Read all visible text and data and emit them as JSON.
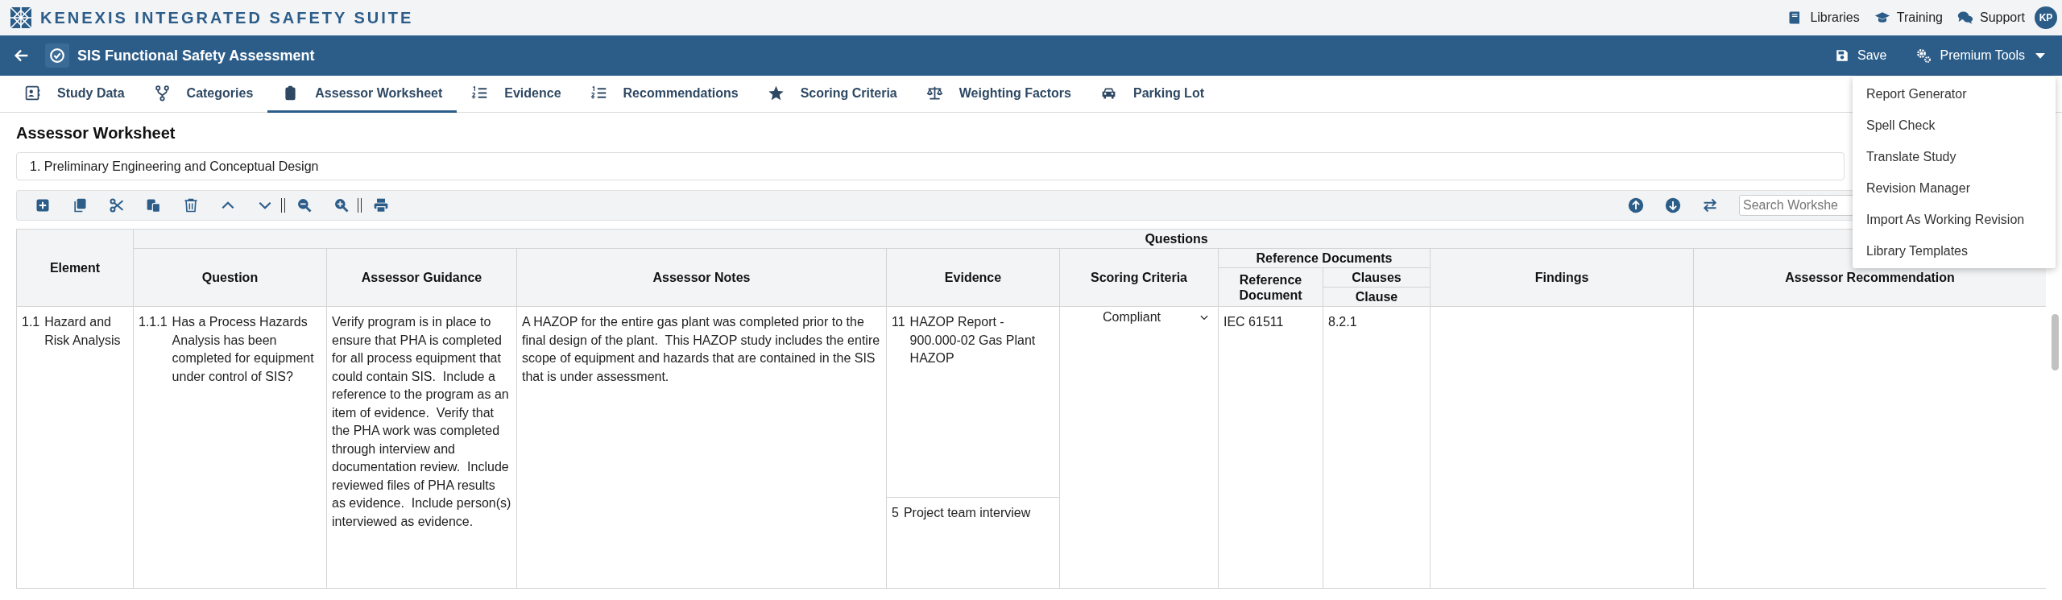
{
  "topbar": {
    "brand": "KENEXIS INTEGRATED SAFETY SUITE",
    "links": [
      {
        "label": "Libraries"
      },
      {
        "label": "Training"
      },
      {
        "label": "Support"
      }
    ],
    "avatar": "KP"
  },
  "header": {
    "title": "SIS Functional Safety Assessment",
    "save": "Save",
    "premium_tools": {
      "label": "Premium Tools",
      "expanded": true,
      "menu": [
        "Report Generator",
        "Spell Check",
        "Translate Study",
        "Revision Manager",
        "Import As Working Revision",
        "Library Templates"
      ]
    }
  },
  "tabs": [
    {
      "label": "Study Data",
      "selected": false
    },
    {
      "label": "Categories",
      "selected": false
    },
    {
      "label": "Assessor Worksheet",
      "selected": true
    },
    {
      "label": "Evidence",
      "selected": false
    },
    {
      "label": "Recommendations",
      "selected": false
    },
    {
      "label": "Scoring Criteria",
      "selected": false
    },
    {
      "label": "Weighting Factors",
      "selected": false
    },
    {
      "label": "Parking Lot",
      "selected": false
    }
  ],
  "page_title": "Assessor Worksheet",
  "category": {
    "value": "1. Preliminary Engineering and Conceptual Design"
  },
  "search": {
    "placeholder": "Search Workshe"
  },
  "table": {
    "headers": {
      "element": "Element",
      "group": "Questions",
      "question": "Question",
      "guidance": "Assessor Guidance",
      "notes": "Assessor Notes",
      "evidence": "Evidence",
      "scoring": "Scoring Criteria",
      "ref_group": "Reference Documents",
      "ref_doc": "Reference Document",
      "clauses_group": "Clauses",
      "clause": "Clause",
      "findings": "Findings",
      "recommendation": "Assessor Recommendation"
    },
    "rows": [
      {
        "element_no": "1.1",
        "element": "Hazard and Risk Analysis",
        "question_no": "1.1.1",
        "question": "Has a Process Hazards Analysis has been completed for equipment under control of SIS?",
        "guidance": "Verify program is in place to ensure that PHA is completed for all process equipment that could contain SIS.  Include a reference to the program as an item of evidence.  Verify that the PHA work was completed through interview and documentation review.  Include reviewed files of PHA results as evidence.  Include person(s) interviewed as evidence.",
        "notes": "A HAZOP for the entire gas plant was completed prior to the final design of the plant.  This HAZOP study includes the entire scope of equipment and hazards that are contained in the SIS that is under assessment.",
        "evidence": [
          {
            "no": "11",
            "text": "HAZOP Report - 900.000-02 Gas Plant HAZOP"
          },
          {
            "no": "5",
            "text": "Project team interview"
          }
        ],
        "scoring": "Compliant",
        "reference_document": "IEC 61511",
        "clause": "8.2.1"
      }
    ]
  }
}
